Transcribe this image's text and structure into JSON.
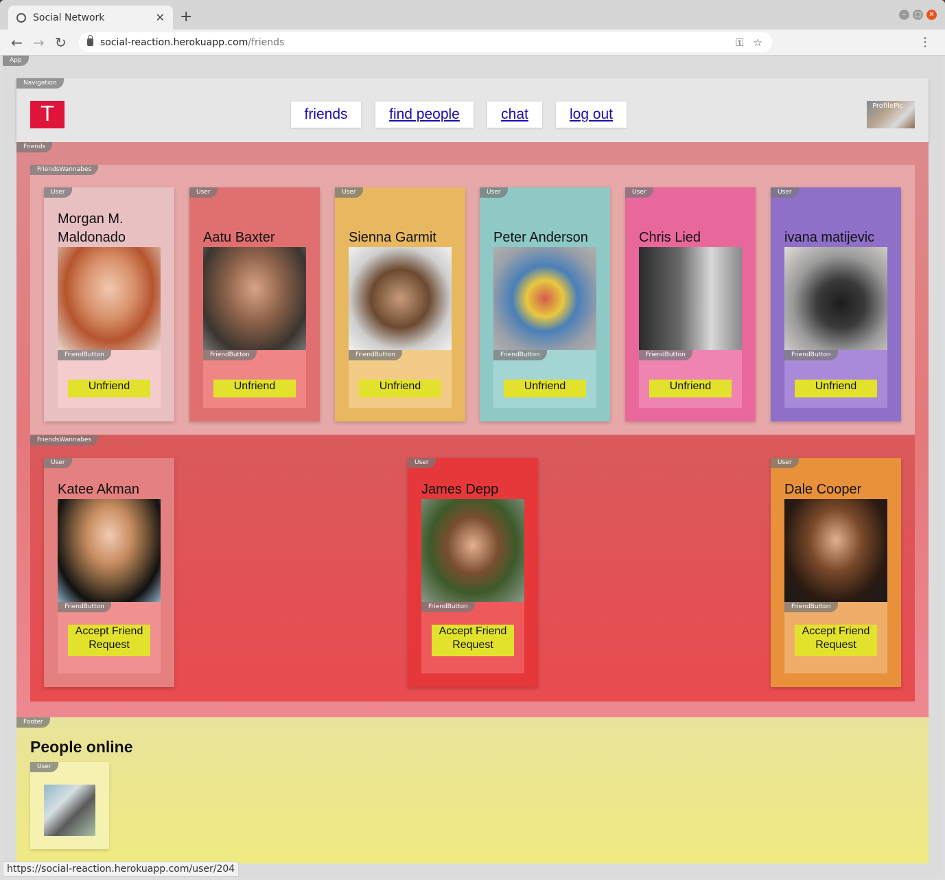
{
  "browser": {
    "tab_title": "Social Network",
    "new_tab": "+",
    "close_tab": "✕",
    "url_host": "social-reaction.herokuapp.com",
    "url_path": "/friends",
    "status_url": "https://social-reaction.herokuapp.com/user/204"
  },
  "labels": {
    "app": "App",
    "navigation": "Navigation",
    "friends": "Friends",
    "wannabes": "FriendsWannabes",
    "user": "User",
    "friend_button": "FriendButton",
    "footer": "Footer",
    "profile_pic": "ProfilePic"
  },
  "nav": {
    "logo": "T",
    "links": [
      "friends",
      "find people",
      "chat",
      "log out"
    ]
  },
  "friends_list": [
    {
      "name": "Morgan M. Maldonado",
      "button": "Unfriend"
    },
    {
      "name": "Aatu Baxter",
      "button": "Unfriend"
    },
    {
      "name": "Sienna Garmit",
      "button": "Unfriend"
    },
    {
      "name": "Peter Anderson",
      "button": "Unfriend"
    },
    {
      "name": "Chris Lied",
      "button": "Unfriend"
    },
    {
      "name": "ivana matijevic",
      "button": "Unfriend"
    }
  ],
  "wannabes_list": [
    {
      "name": "Katee Akman",
      "button": "Accept Friend Request"
    },
    {
      "name": "James Depp",
      "button": "Accept Friend Request"
    },
    {
      "name": "Dale Cooper",
      "button": "Accept Friend Request"
    }
  ],
  "footer": {
    "title": "People online"
  },
  "colors": {
    "card_pink": "#e9c0c1",
    "card_red": "#e07070",
    "card_yellow": "#e8b860",
    "card_teal": "#8ec9c5",
    "card_magenta": "#e9689c",
    "card_purple": "#8f70c9"
  }
}
